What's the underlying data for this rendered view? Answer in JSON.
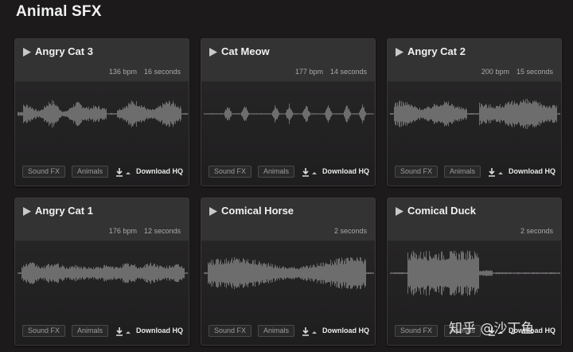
{
  "page": {
    "title": "Animal SFX"
  },
  "sounds": [
    {
      "title": "Angry Cat 3",
      "bpm": "136 bpm",
      "duration": "16 seconds",
      "tags": [
        "Sound FX",
        "Animals"
      ],
      "download_label": "Download HQ",
      "waveform": "cat3"
    },
    {
      "title": "Cat Meow",
      "bpm": "177 bpm",
      "duration": "14 seconds",
      "tags": [
        "Sound FX",
        "Animals"
      ],
      "download_label": "Download HQ",
      "waveform": "meow"
    },
    {
      "title": "Angry Cat 2",
      "bpm": "200 bpm",
      "duration": "15 seconds",
      "tags": [
        "Sound FX",
        "Animals"
      ],
      "download_label": "Download HQ",
      "waveform": "cat2"
    },
    {
      "title": "Angry Cat 1",
      "bpm": "176 bpm",
      "duration": "12 seconds",
      "tags": [
        "Sound FX",
        "Animals"
      ],
      "download_label": "Download HQ",
      "waveform": "cat1"
    },
    {
      "title": "Comical Horse",
      "bpm": "",
      "duration": "2 seconds",
      "tags": [
        "Sound FX",
        "Animals"
      ],
      "download_label": "Download HQ",
      "waveform": "horse"
    },
    {
      "title": "Comical Duck",
      "bpm": "",
      "duration": "2 seconds",
      "tags": [
        "Sound FX",
        "Animals"
      ],
      "download_label": "Download HQ",
      "waveform": "duck"
    }
  ],
  "watermark": "知乎 @沙丁鱼",
  "colors": {
    "background": "#1c1a1b",
    "card": "#262526",
    "waveform": "#6e6d6e",
    "accent_text": "#f0f0f0"
  },
  "icons": {
    "play": "play-triangle-icon",
    "download": "download-arrow-icon"
  }
}
